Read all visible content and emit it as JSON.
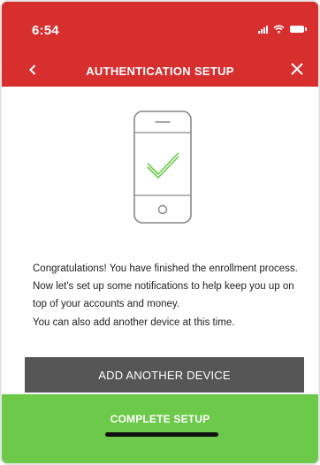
{
  "status_bar": {
    "time": "6:54"
  },
  "nav": {
    "title": "AUTHENTICATION SETUP",
    "back_icon": "chevron-left-icon",
    "close_icon": "close-icon"
  },
  "illustration": {
    "name": "phone-checkmark-icon",
    "check_color": "#6cc94a",
    "outline_color": "#888888"
  },
  "message": {
    "paragraph1": "Congratulations! You have finished the enrollment process. Now let's set up some notifications to help keep you up on top of your accounts and money.",
    "paragraph2": "You can also add another device at this time."
  },
  "buttons": {
    "add_device": "ADD ANOTHER DEVICE",
    "complete_setup": "COMPLETE SETUP"
  },
  "colors": {
    "brand_red": "#d72e2e",
    "primary_green": "#6cc94a",
    "secondary_gray": "#565656"
  }
}
